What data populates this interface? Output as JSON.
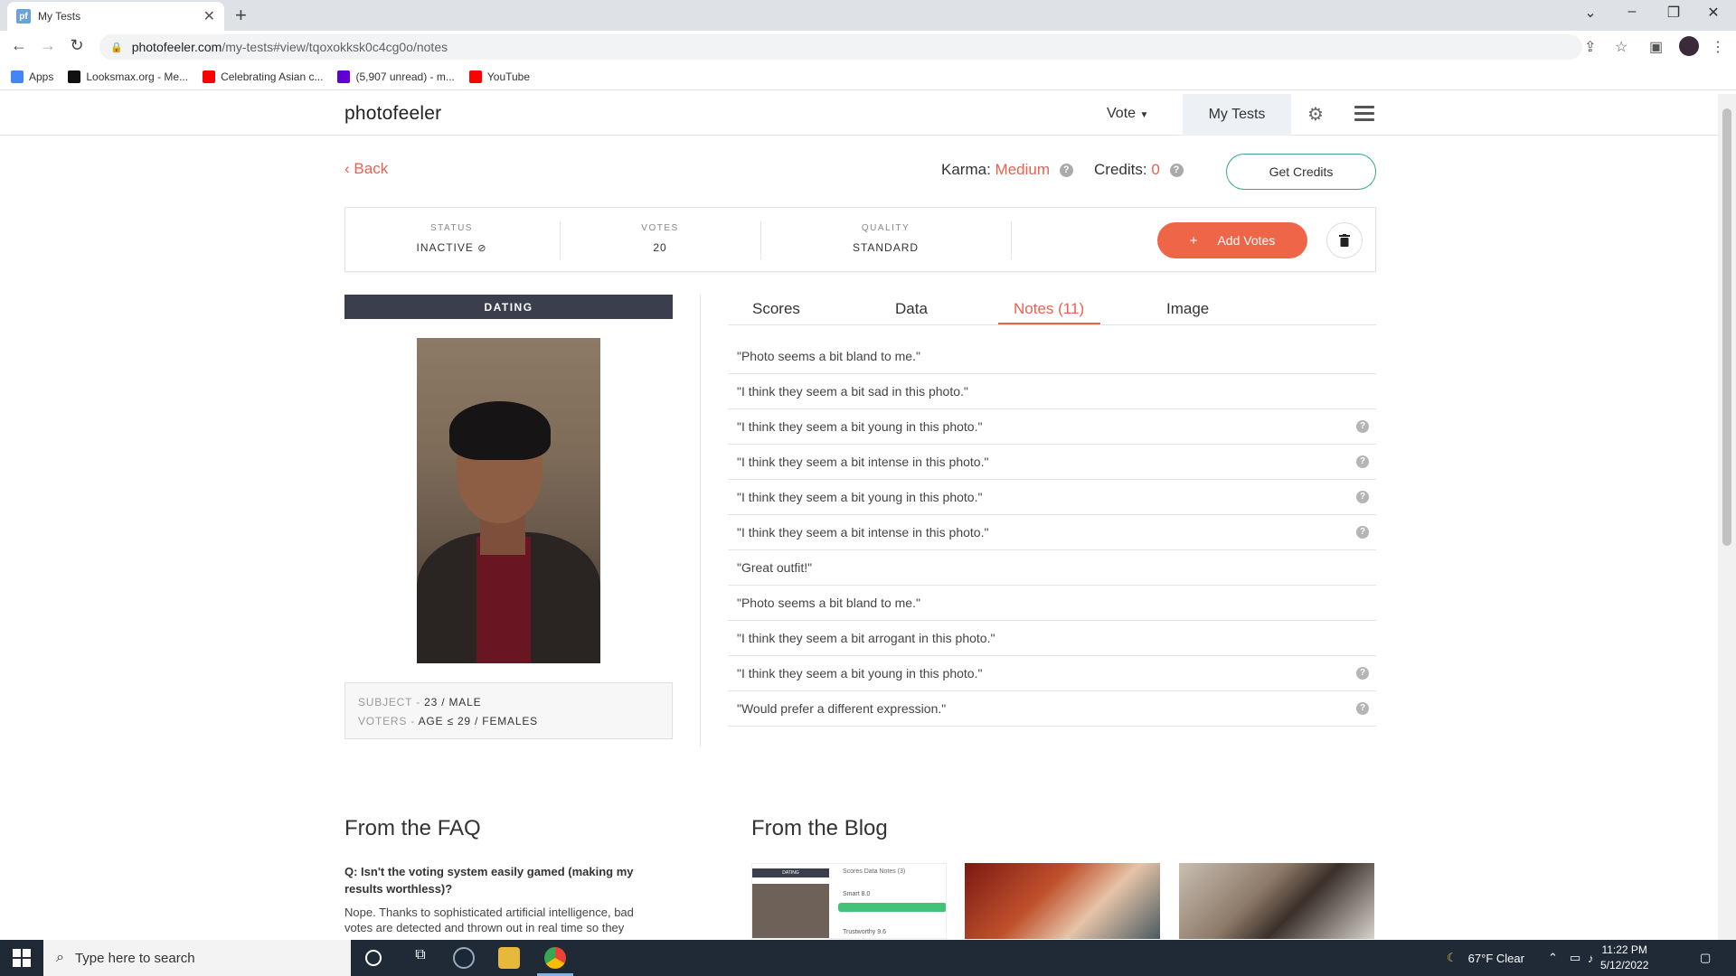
{
  "browser": {
    "tab_title": "My Tests",
    "favicon_text": "pf",
    "url_host": "photofeeler.com",
    "url_path": "/my-tests#view/tqoxokksk0c4cg0o/notes",
    "bookmarks": [
      {
        "label": "Apps",
        "color": "#4285f4"
      },
      {
        "label": "Looksmax.org - Me...",
        "color": "#111111"
      },
      {
        "label": "Celebrating Asian c...",
        "color": "#ff0000"
      },
      {
        "label": "(5,907 unread) - m...",
        "color": "#6001d2"
      },
      {
        "label": "YouTube",
        "color": "#ff0000"
      }
    ]
  },
  "header": {
    "logo": "photofeeler",
    "nav_vote": "Vote",
    "nav_mytests": "My Tests"
  },
  "top": {
    "back": "Back",
    "karma_label": "Karma:",
    "karma_value": "Medium",
    "credits_label": "Credits:",
    "credits_value": "0",
    "get_credits": "Get Credits"
  },
  "status": {
    "status_label": "STATUS",
    "status_value": "INACTIVE",
    "votes_label": "VOTES",
    "votes_value": "20",
    "quality_label": "QUALITY",
    "quality_value": "STANDARD",
    "add_votes": "Add Votes"
  },
  "left": {
    "category": "DATING",
    "subject_key": "SUBJECT",
    "subject_value": "23 / MALE",
    "voters_key": "VOTERS",
    "voters_value": "AGE ≤ 29 / FEMALES"
  },
  "tabs": [
    "Scores",
    "Data",
    "Notes (11)",
    "Image"
  ],
  "notes": [
    {
      "text": "\"Photo seems a bit bland to me.\"",
      "help": false
    },
    {
      "text": "\"I think they seem a bit sad in this photo.\"",
      "help": false
    },
    {
      "text": "\"I think they seem a bit young in this photo.\"",
      "help": true
    },
    {
      "text": "\"I think they seem a bit intense in this photo.\"",
      "help": true
    },
    {
      "text": "\"I think they seem a bit young in this photo.\"",
      "help": true
    },
    {
      "text": "\"I think they seem a bit intense in this photo.\"",
      "help": true
    },
    {
      "text": "\"Great outfit!\"",
      "help": false
    },
    {
      "text": "\"Photo seems a bit bland to me.\"",
      "help": false
    },
    {
      "text": "\"I think they seem a bit arrogant in this photo.\"",
      "help": false
    },
    {
      "text": "\"I think they seem a bit young in this photo.\"",
      "help": true
    },
    {
      "text": "\"Would prefer a different expression.\"",
      "help": true
    }
  ],
  "faq": {
    "title": "From the FAQ",
    "question": "Q: Isn't the voting system easily gamed (making my results worthless)?",
    "answer": "Nope. Thanks to sophisticated artificial intelligence, bad votes are detected and thrown out in real time so they"
  },
  "blog": {
    "title": "From the Blog",
    "thumb1_bar": "DATING",
    "thumb1_tabs": "Scores    Data    Notes (3)",
    "thumb1_smart": "Smart 8.0",
    "thumb1_trust": "Trustworthy 9.6"
  },
  "taskbar": {
    "search_placeholder": "Type here to search",
    "weather": "67°F  Clear",
    "time": "11:22 PM",
    "date": "5/12/2022"
  }
}
